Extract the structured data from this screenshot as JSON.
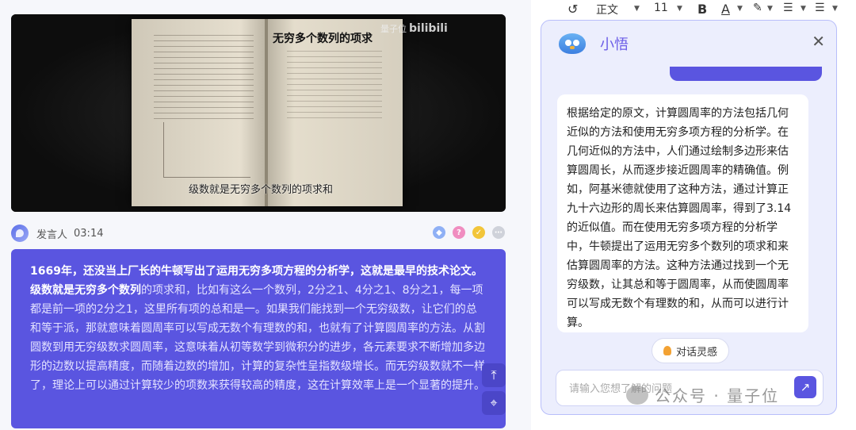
{
  "video": {
    "title_overlay": "无穷多个数列的项求",
    "logo_text": "量子位",
    "logo_brand": "bilibili",
    "subtitle": "级数就是无穷多个数列的项求和"
  },
  "speaker": {
    "name": "发言人",
    "time": "03:14"
  },
  "transcript": {
    "highlight_1": "1669年，还没当上厂长的牛顿写出了运用无穷多项方程的分析学，这就是最早的技术论文。",
    "highlight_2": "级数就是无穷多个数列",
    "body": "的项求和，比如有这么一个数列，2分之1、4分之1、8分之1，每一项都是前一项的2分之1，这里所有项的总和是一。如果我们能找到一个无穷级数，让它们的总和等于派，那就意味着圆周率可以写成无数个有理数的和，也就有了计算圆周率的方法。从割圆数到用无穷级数求圆周率，这意味着从初等数学到微积分的进步，各元素要求不断增加多边形的边数以提高精度，而随着边数的增加，计算的复杂性呈指数级增长。而无穷级数就不一样了，理论上可以通过计算较少的项数来获得较高的精度，这在计算效率上是一个显著的提升。"
  },
  "toolbar": {
    "style": "正文",
    "size": "11",
    "bold": "B",
    "font_color": "A"
  },
  "assistant": {
    "title": "小悟",
    "answer": "根据给定的原文，计算圆周率的方法包括几何近似的方法和使用无穷多项方程的分析学。在几何近似的方法中，人们通过绘制多边形来估算圆周长，从而逐步接近圆周率的精确值。例如，阿基米德就使用了这种方法，通过计算正九十六边形的周长来估算圆周率，得到了3.14的近似值。而在使用无穷多项方程的分析学中，牛顿提出了运用无穷多个数列的项求和来估算圆周率的方法。这种方法通过找到一个无穷级数，让其总和等于圆周率，从而使圆周率可以写成无数个有理数的和，从而可以进行计算。",
    "inspire_label": "对话灵感",
    "input_placeholder": "请输入您想了解的问题"
  },
  "watermark": {
    "text": "公众号 · 量子位"
  },
  "colors": {
    "accent": "#5a55e0",
    "panel_bg": "#eceefd"
  }
}
